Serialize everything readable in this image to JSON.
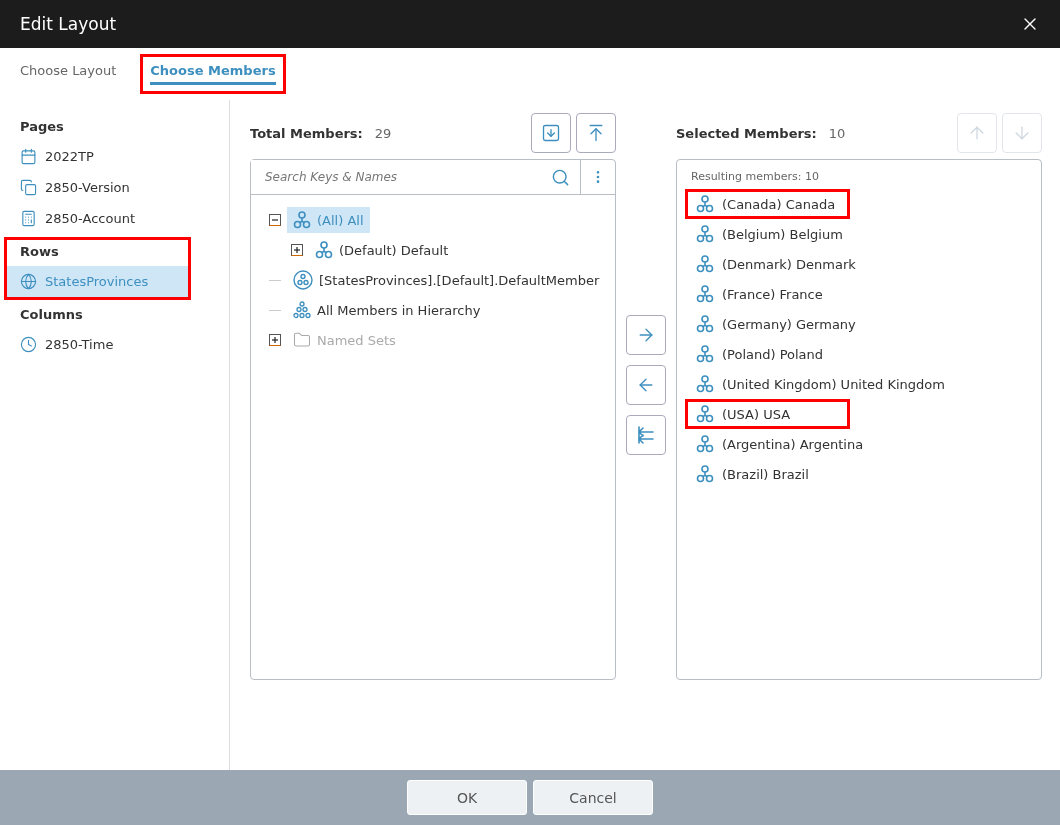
{
  "window": {
    "title": "Edit Layout"
  },
  "tabs": [
    {
      "label": "Choose Layout",
      "selected": false,
      "highlighted": false
    },
    {
      "label": "Choose Members",
      "selected": true,
      "highlighted": true
    }
  ],
  "sidebar": {
    "sections": [
      {
        "title": "Pages",
        "highlighted": false,
        "items": [
          {
            "label": "2022TP",
            "kind": "calendar",
            "selected": false
          },
          {
            "label": "2850-Version",
            "kind": "copy",
            "selected": false
          },
          {
            "label": "2850-Account",
            "kind": "calculator",
            "selected": false
          }
        ]
      },
      {
        "title": "Rows",
        "highlighted": true,
        "items": [
          {
            "label": "StatesProvinces",
            "kind": "globe",
            "selected": true
          }
        ]
      },
      {
        "title": "Columns",
        "highlighted": false,
        "items": [
          {
            "label": "2850-Time",
            "kind": "clock",
            "selected": false
          }
        ]
      }
    ]
  },
  "total_members": {
    "label": "Total Members:",
    "count": "29",
    "toolbar": [
      {
        "kind": "import",
        "disabled": false
      },
      {
        "kind": "export",
        "disabled": false
      }
    ]
  },
  "search": {
    "placeholder": "Search Keys & Names"
  },
  "tree": [
    {
      "label": "(All) All",
      "kind": "member",
      "selected": true,
      "disabled": false,
      "expanded": true,
      "children": [
        {
          "label": "(Default) Default",
          "kind": "member",
          "selected": false,
          "disabled": false,
          "expanded": false
        }
      ]
    },
    {
      "label": "[StatesProvinces].[Default].DefaultMember",
      "kind": "default-member",
      "selected": false,
      "disabled": false
    },
    {
      "label": "All Members in Hierarchy",
      "kind": "all-members",
      "selected": false,
      "disabled": false
    },
    {
      "label": "Named Sets",
      "kind": "folder",
      "selected": false,
      "disabled": true,
      "expanded": false
    }
  ],
  "transfer_buttons": [
    {
      "kind": "add"
    },
    {
      "kind": "remove"
    },
    {
      "kind": "remove-all"
    }
  ],
  "selected_members": {
    "label": "Selected Members:",
    "count": "10",
    "toolbar": [
      {
        "kind": "up",
        "disabled": true
      },
      {
        "kind": "down",
        "disabled": true
      }
    ],
    "summary": "Resulting members: 10",
    "items": [
      {
        "label": "(Canada) Canada",
        "highlighted": true
      },
      {
        "label": "(Belgium) Belgium",
        "highlighted": false
      },
      {
        "label": "(Denmark) Denmark",
        "highlighted": false
      },
      {
        "label": "(France) France",
        "highlighted": false
      },
      {
        "label": "(Germany) Germany",
        "highlighted": false
      },
      {
        "label": "(Poland) Poland",
        "highlighted": false
      },
      {
        "label": "(United Kingdom) United Kingdom",
        "highlighted": false
      },
      {
        "label": "(USA) USA",
        "highlighted": true
      },
      {
        "label": "(Argentina) Argentina",
        "highlighted": false
      },
      {
        "label": "(Brazil) Brazil",
        "highlighted": false
      }
    ]
  },
  "footer": {
    "buttons": [
      "OK",
      "Cancel"
    ]
  }
}
